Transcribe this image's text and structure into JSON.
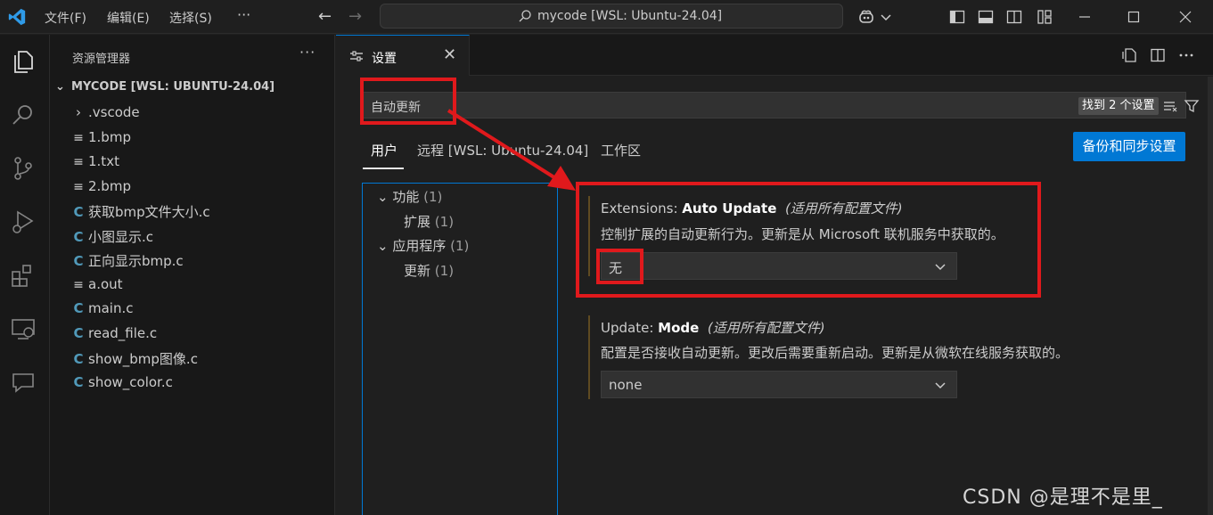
{
  "titlebar": {
    "menus": [
      "文件(F)",
      "编辑(E)",
      "选择(S)",
      "···"
    ],
    "search_text": "mycode [WSL: Ubuntu-24.04]"
  },
  "sidebar": {
    "title": "资源管理器",
    "more": "···",
    "root": "MYCODE [WSL: UBUNTU-24.04]",
    "files": [
      {
        "name": ".vscode",
        "type": "folder"
      },
      {
        "name": "1.bmp",
        "type": "text"
      },
      {
        "name": "1.txt",
        "type": "text"
      },
      {
        "name": "2.bmp",
        "type": "text"
      },
      {
        "name": "获取bmp文件大小.c",
        "type": "c"
      },
      {
        "name": "小图显示.c",
        "type": "c"
      },
      {
        "name": "正向显示bmp.c",
        "type": "c"
      },
      {
        "name": "a.out",
        "type": "text"
      },
      {
        "name": "main.c",
        "type": "c"
      },
      {
        "name": "read_file.c",
        "type": "c"
      },
      {
        "name": "show_bmp图像.c",
        "type": "c"
      },
      {
        "name": "show_color.c",
        "type": "c"
      }
    ]
  },
  "editor": {
    "tab_label": "设置",
    "tab_close": "✕"
  },
  "settings": {
    "search_value": "自动更新",
    "result_badge": "找到 2 个设置",
    "scopes": [
      "用户",
      "远程 [WSL: Ubuntu-24.04]",
      "工作区"
    ],
    "sync_button": "备份和同步设置",
    "toc": [
      {
        "label": "功能",
        "count": "(1)",
        "level": 0
      },
      {
        "label": "扩展",
        "count": "(1)",
        "level": 1
      },
      {
        "label": "应用程序",
        "count": "(1)",
        "level": 0
      },
      {
        "label": "更新",
        "count": "(1)",
        "level": 1
      }
    ],
    "items": [
      {
        "category": "Extensions: ",
        "name": "Auto Update",
        "scope_note": "(适用所有配置文件)",
        "description": "控制扩展的自动更新行为。更新是从 Microsoft 联机服务中获取的。",
        "value": "无"
      },
      {
        "category": "Update: ",
        "name": "Mode",
        "scope_note": "(适用所有配置文件)",
        "description": "配置是否接收自动更新。更改后需要重新启动。更新是从微软在线服务获取的。",
        "value": "none"
      }
    ]
  },
  "watermark": "CSDN @是理不是里_",
  "colors": {
    "accent": "#0078d4",
    "annotation_red": "#e0191c",
    "modified_bar": "#5f4a21"
  }
}
